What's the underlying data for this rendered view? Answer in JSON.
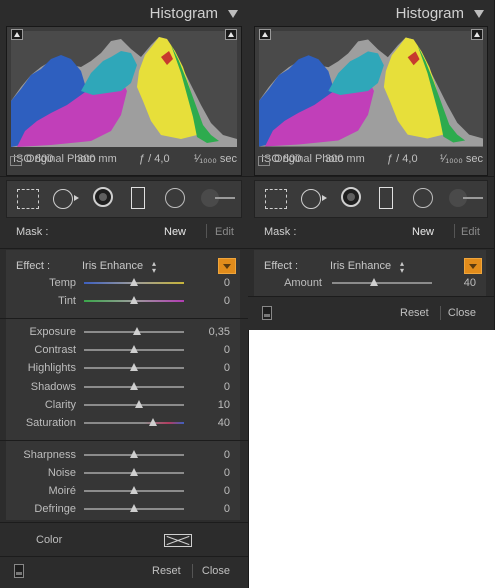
{
  "histogram": {
    "title": "Histogram",
    "iso": "ISO 800",
    "focal_length": "300 mm",
    "aperture": "ƒ / 4,0",
    "shutter": "¹⁄₁₀₀₀ sec",
    "original_photo_label": "Original Photo"
  },
  "mask": {
    "label": "Mask :",
    "new": "New",
    "edit": "Edit"
  },
  "effect": {
    "label": "Effect :",
    "value": "Iris Enhance"
  },
  "left_sliders": [
    {
      "label": "Temp",
      "value": "0",
      "pos": 0.5,
      "track": "temp"
    },
    {
      "label": "Tint",
      "value": "0",
      "pos": 0.5,
      "track": "tint"
    },
    {
      "label": "Exposure",
      "value": "0,35",
      "pos": 0.53,
      "track": "plain"
    },
    {
      "label": "Contrast",
      "value": "0",
      "pos": 0.5,
      "track": "plain"
    },
    {
      "label": "Highlights",
      "value": "0",
      "pos": 0.5,
      "track": "plain"
    },
    {
      "label": "Shadows",
      "value": "0",
      "pos": 0.5,
      "track": "plain"
    },
    {
      "label": "Clarity",
      "value": "10",
      "pos": 0.55,
      "track": "plain"
    },
    {
      "label": "Saturation",
      "value": "40",
      "pos": 0.69,
      "track": "sat"
    },
    {
      "label": "Sharpness",
      "value": "0",
      "pos": 0.5,
      "track": "plain"
    },
    {
      "label": "Noise",
      "value": "0",
      "pos": 0.5,
      "track": "plain"
    },
    {
      "label": "Moiré",
      "value": "0",
      "pos": 0.5,
      "track": "plain"
    },
    {
      "label": "Defringe",
      "value": "0",
      "pos": 0.5,
      "track": "plain"
    }
  ],
  "color_label": "Color",
  "right_amount": {
    "label": "Amount",
    "value": "40",
    "pos": 0.42
  },
  "footer": {
    "reset": "Reset",
    "close": "Close"
  },
  "colors": {
    "accent": "#e28c1b",
    "panel": "#2c2c2c"
  }
}
